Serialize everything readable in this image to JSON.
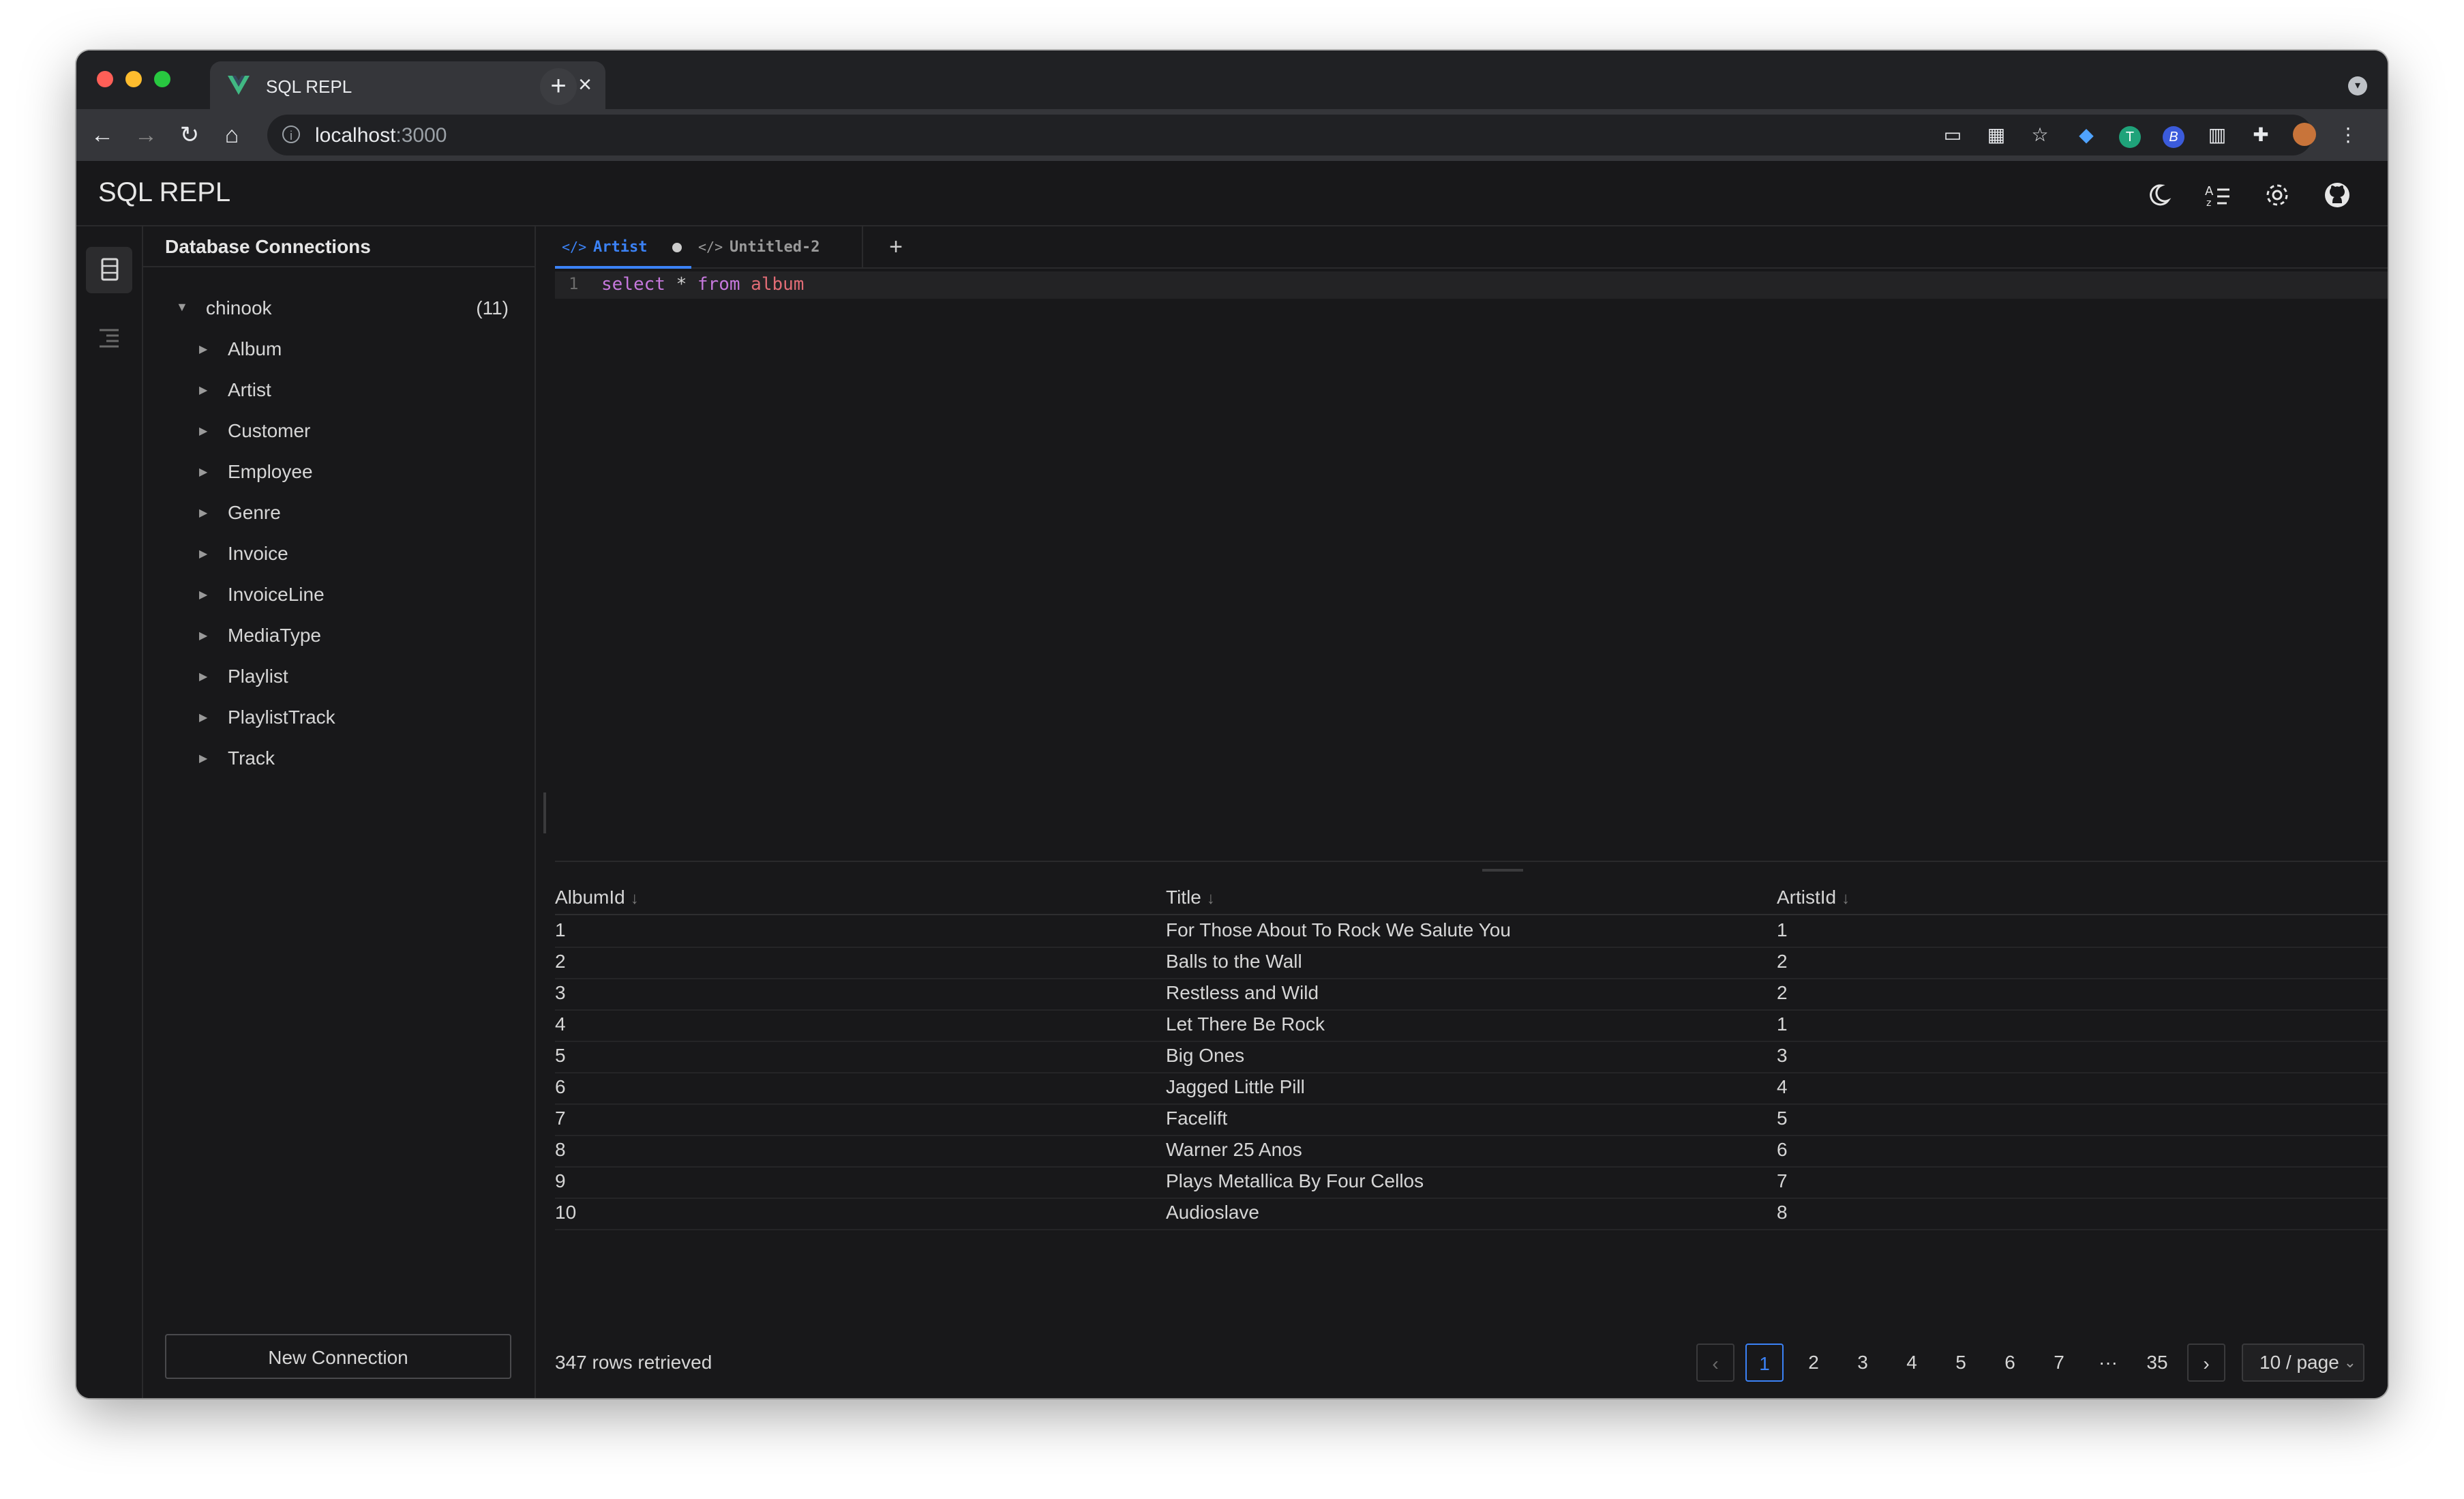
{
  "browser": {
    "tab_title": "SQL REPL",
    "url_host": "localhost",
    "url_port": ":3000"
  },
  "app": {
    "title": "SQL REPL"
  },
  "sidebar": {
    "title": "Database Connections",
    "database": {
      "name": "chinook",
      "count": "(11)"
    },
    "tables": [
      "Album",
      "Artist",
      "Customer",
      "Employee",
      "Genre",
      "Invoice",
      "InvoiceLine",
      "MediaType",
      "Playlist",
      "PlaylistTrack",
      "Track"
    ],
    "new_connection_label": "New Connection"
  },
  "editor": {
    "tabs": [
      {
        "label": "Artist",
        "active": true,
        "unsaved": true
      },
      {
        "label": "Untitled-2",
        "active": false,
        "unsaved": false
      }
    ],
    "line_number": "1",
    "query_tokens": {
      "kw1": "select",
      "op": "*",
      "kw2": "from",
      "table": "album"
    }
  },
  "results": {
    "columns": [
      "AlbumId",
      "Title",
      "ArtistId"
    ],
    "rows": [
      [
        "1",
        "For Those About To Rock We Salute You",
        "1"
      ],
      [
        "2",
        "Balls to the Wall",
        "2"
      ],
      [
        "3",
        "Restless and Wild",
        "2"
      ],
      [
        "4",
        "Let There Be Rock",
        "1"
      ],
      [
        "5",
        "Big Ones",
        "3"
      ],
      [
        "6",
        "Jagged Little Pill",
        "4"
      ],
      [
        "7",
        "Facelift",
        "5"
      ],
      [
        "8",
        "Warner 25 Anos",
        "6"
      ],
      [
        "9",
        "Plays Metallica By Four Cellos",
        "7"
      ],
      [
        "10",
        "Audioslave",
        "8"
      ]
    ],
    "status": "347 rows retrieved",
    "pagination": {
      "pages": [
        "1",
        "2",
        "3",
        "4",
        "5",
        "6",
        "7",
        "···",
        "35"
      ],
      "current": "1",
      "page_size": "10 / page"
    }
  },
  "colors": {
    "accent": "#3b82f6",
    "keyword": "#c678dd",
    "identifier": "#e06c75"
  }
}
